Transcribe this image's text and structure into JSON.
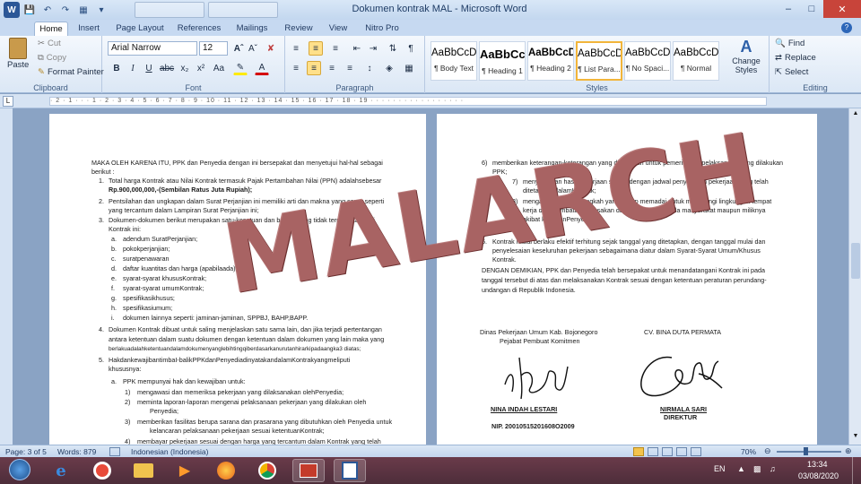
{
  "window": {
    "title": "Dokumen kontrak MAL - Microsoft Word"
  },
  "ribbon": {
    "tabs": [
      "Home",
      "Insert",
      "Page Layout",
      "References",
      "Mailings",
      "Review",
      "View",
      "Nitro Pro"
    ],
    "active_tab": "Home",
    "clipboard": {
      "label": "Clipboard",
      "paste": "Paste",
      "cut": "Cut",
      "copy": "Copy",
      "format_painter": "Format Painter"
    },
    "font": {
      "label": "Font",
      "name": "Arial Narrow",
      "size": "12"
    },
    "paragraph": {
      "label": "Paragraph"
    },
    "styles": {
      "label": "Styles",
      "items": [
        {
          "preview": "AaBbCcD",
          "name": "¶ Body Text"
        },
        {
          "preview": "AaBbCc",
          "name": "¶ Heading 1"
        },
        {
          "preview": "AaBbCcD",
          "name": "¶ Heading 2"
        },
        {
          "preview": "AaBbCcDc",
          "name": "¶ List Para..."
        },
        {
          "preview": "AaBbCcDc",
          "name": "¶ No Spaci..."
        },
        {
          "preview": "AaBbCcDc",
          "name": "¶ Normal"
        }
      ],
      "change_styles": "Change Styles"
    },
    "editing": {
      "label": "Editing",
      "find": "Find",
      "replace": "Replace",
      "select": "Select"
    }
  },
  "ruler": {
    "marks": "· 2 · 1 · · · 1 · 2 · 3 · 4 · 5 · 6 · 7 · 8 · 9 · 10 · 11 · 12 · 13 · 14 · 15 · 16 · 17 · 18 · 19 · · · · · · · · · · · · · · · · ·"
  },
  "document": {
    "left_page": {
      "intro1": "MAKA OLEH KARENA ITU, PPK dan Penyedia dengan ini bersepakat dan menyetujui hal-hal sebagai",
      "intro2": "berikut :",
      "item1_num": "1.",
      "item1_l1": "Total harga Kontrak atau Nilai Kontrak termasuk Pajak Pertambahan Nilai (PPN) adalahsebesar",
      "item1_l2": "Rp.900,000,000,-(Sembilan Ratus Juta Rupiah);",
      "item2_num": "2.",
      "item2_l1": "Pentsilahan dan ungkapan dalam Surat Perjanjian ini memiliki arti dan makna yang sama seperti",
      "item2_l2": "yang tercantum dalam Lampiran Surat Perjanjian ini;",
      "item3_num": "3.",
      "item3_l1": "Dokumen-dokumen berikut merupakan satu-kesatuan dan bagian yang tidak terpisahkan dari",
      "item3_l2": "Kontrak ini:",
      "sub_items": [
        {
          "letter": "a.",
          "text": "adendum SuratPerjanjian;"
        },
        {
          "letter": "b.",
          "text": "pokokperjanjian;"
        },
        {
          "letter": "c.",
          "text": "suratpenawaran"
        },
        {
          "letter": "d.",
          "text": "daftar kuantitas dan harga (apabilaada);"
        },
        {
          "letter": "e.",
          "text": "syarat-syarat khususKontrak;"
        },
        {
          "letter": "f.",
          "text": "syarat-syarat umumKontrak;"
        },
        {
          "letter": "g.",
          "text": "spesifikasikhusus;"
        },
        {
          "letter": "h.",
          "text": "spesifikasiumum;"
        },
        {
          "letter": "i.",
          "text": "dokumen lainnya seperti: jaminan-jaminan, SPPBJ, BAHP,BAPP."
        }
      ],
      "item4_num": "4.",
      "item4_l1": "Dokumen Kontrak dibuat untuk saling menjelaskan satu sama lain, dan jika terjadi pertentangan",
      "item4_l2": "antara ketentuan dalam suatu dokumen dengan ketentuan dalam dokumen yang lain maka yang",
      "item4_l3": "berlakuadalahketentuandalamdokumenyanglebihtingqiberdasarkanurutanhirarkipadaangka3 diatas;",
      "item5_num": "5.",
      "item5_l1": "HakdankewajibantimbaI-balikPPKdanPenyediadinyatakandalamKontrakyangmeliputi",
      "item5_l2": "khususnya:",
      "item5a_letter": "a.",
      "item5a_text": "PPK mempunyai hak dan kewajiban untuk:",
      "item5a_subs": [
        {
          "num": "1)",
          "text": "mengawasi dan memeriksa pekerjaan yang dilaksanakan olehPenyedia;"
        },
        {
          "num": "2)",
          "text": "meminta laporan-laporan mengenai pelaksanaan pekerjaan yang dilakukan oleh"
        },
        {
          "num": "",
          "text": "Penyedia;"
        },
        {
          "num": "3)",
          "text": "memberikan fasilitas berupa sarana dan prasarana yang dibutuhkan oleh Penyedia untuk"
        },
        {
          "num": "",
          "text": "kelancaran pelaksanaan pekerjaan sesuai ketentuanKontrak;"
        },
        {
          "num": "4)",
          "text": "membayar pekerjaan sesuai dengan harga yang tercantum dalam Kontrak yang telah"
        }
      ]
    },
    "right_page": {
      "item6_num": "6)",
      "item6_l1": "memberikan keterangan-keterangan yang diperlukan untuk pemeriksaan pelaksanaan yang dilakukan",
      "item6_l2": "PPK;",
      "item7_num": "7)",
      "item7_l1": "menyerahkan hasil pekerjaan sesuai dengan jadwal penyerahan pekerjaan yang telah",
      "item7_l2": "ditetapkan dalamKontrak;",
      "item8_num": "8)",
      "item8_l1": "mengambil langkah-langkah yang cukup memadai untuk melindungi lingkungan tempat",
      "item8_l2": "kerja dan membatasi kerusakan dan gangguan kepada masyarakat maupun miliknya",
      "item8_l3": "akibat kegiatanPenyedia.",
      "item6b_num": "6.",
      "item6b_l1": "Kontrak mulai berlaku efektif terhitung sejak tanggal yang ditetapkan, dengan tanggal mulai dan",
      "item6b_l2": "penyelesaian keseluruhan pekerjaan sebagaimana diatur dalam Syarat-Syarat Umum/Khusus",
      "item6b_l3": "Kontrak.",
      "closing_l1": "DENGAN DEMIKIAN, PPK dan Penyedia telah bersepakat untuk menandatangani Kontrak ini pada",
      "closing_l2": "tanggal tersebut di atas dan melaksanakan Kontrak sesuai dengan ketentuan peraturan perundang-",
      "closing_l3": "undangan di Republik Indonesia.",
      "sig_left_org1": "Dinas Pekerjaan Umum Kab. Bojonegoro",
      "sig_left_org2": "Pejabat Pembuat Komitmen",
      "sig_left_name": "NINA INDAH LESTARI",
      "sig_left_nip": "NIP. 20010515201608O2009",
      "sig_right_org": "CV. BINA DUTA PERMATA",
      "sig_right_name": "NIRMALA SARI",
      "sig_right_title": "DIREKTUR"
    },
    "watermark": "MALARCH"
  },
  "status": {
    "page": "Page: 3 of 5",
    "words": "Words: 879",
    "language": "Indonesian (Indonesia)",
    "zoom": "70%"
  },
  "taskbar": {
    "lang": "EN",
    "time": "13:34",
    "date": "03/08/2020"
  },
  "icons": [
    "word-icon",
    "save-icon",
    "undo-icon",
    "redo-icon",
    "scissors-icon",
    "copy-icon",
    "brush-icon",
    "binoculars-icon",
    "windows-start-icon",
    "ie-icon",
    "firefox-icon",
    "chrome-icon"
  ]
}
